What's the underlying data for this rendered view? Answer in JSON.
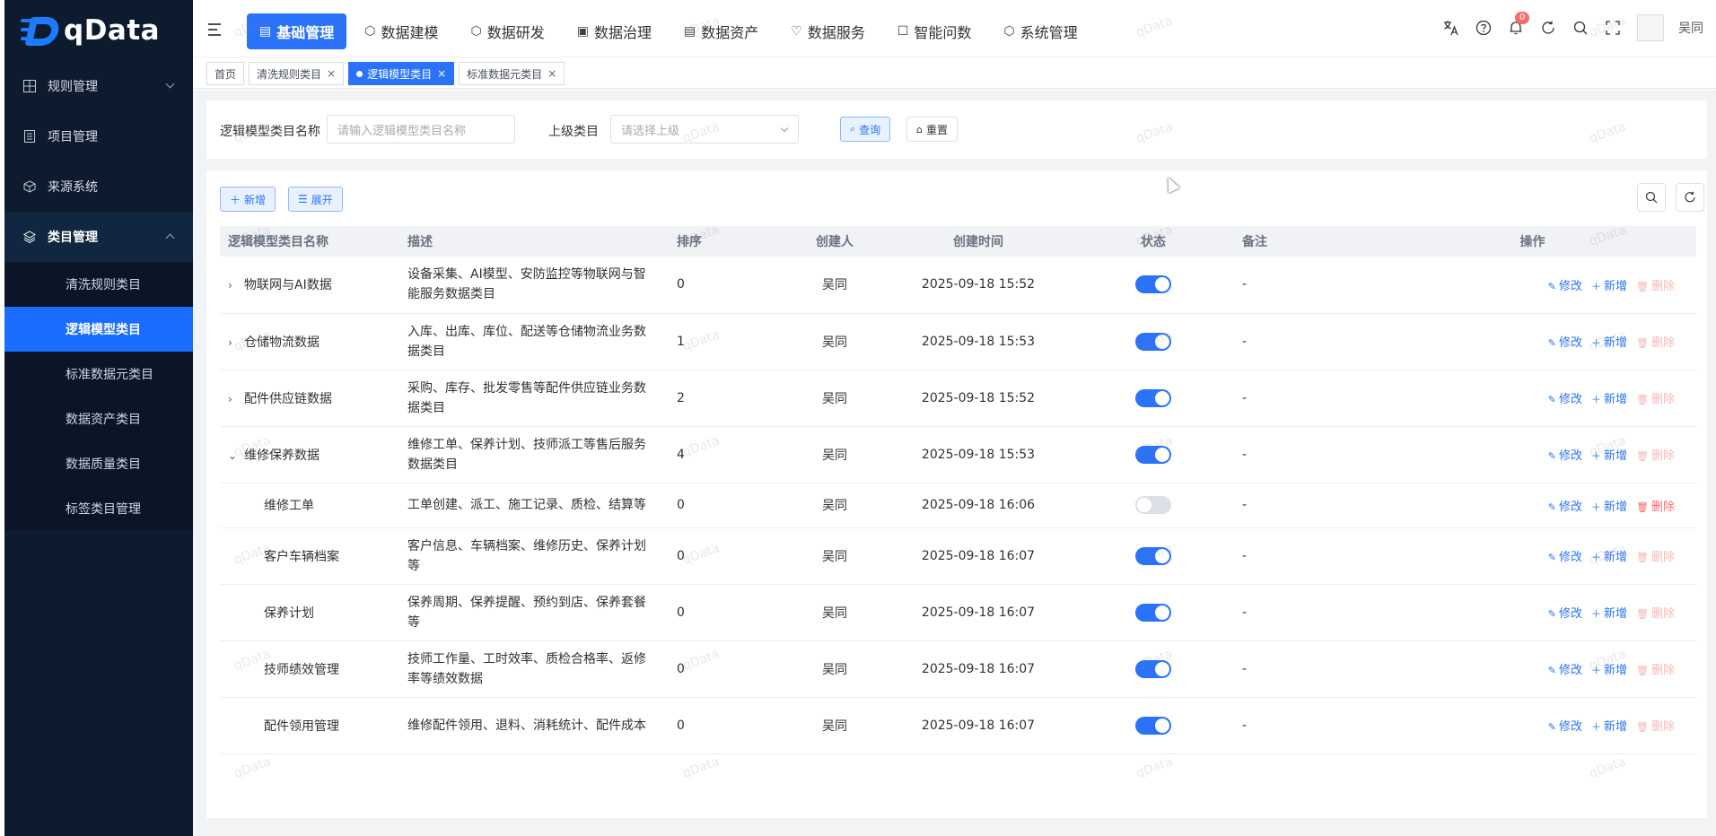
{
  "app": {
    "logo_text": "qData"
  },
  "sidebar": {
    "items": [
      {
        "label": "规则管理",
        "icon": "grid-icon"
      },
      {
        "label": "项目管理",
        "icon": "document-icon"
      },
      {
        "label": "来源系统",
        "icon": "cube-icon"
      },
      {
        "label": "类目管理",
        "icon": "layers-icon"
      }
    ],
    "sub_items": [
      {
        "label": "清洗规则类目"
      },
      {
        "label": "逻辑模型类目"
      },
      {
        "label": "标准数据元类目"
      },
      {
        "label": "数据资产类目"
      },
      {
        "label": "数据质量类目"
      },
      {
        "label": "标签类目管理"
      }
    ]
  },
  "topnav": {
    "items": [
      {
        "label": "基础管理",
        "icon": "▤"
      },
      {
        "label": "数据建模",
        "icon": "⬡"
      },
      {
        "label": "数据研发",
        "icon": "⬡"
      },
      {
        "label": "数据治理",
        "icon": "▣"
      },
      {
        "label": "数据资产",
        "icon": "▤"
      },
      {
        "label": "数据服务",
        "icon": "♡"
      },
      {
        "label": "智能问数",
        "icon": "☐"
      },
      {
        "label": "系统管理",
        "icon": "⬡"
      }
    ],
    "badge_count": "0",
    "user_name": "吴同"
  },
  "tabs": [
    {
      "label": "首页"
    },
    {
      "label": "清洗规则类目"
    },
    {
      "label": "逻辑模型类目"
    },
    {
      "label": "标准数据元类目"
    }
  ],
  "search": {
    "name_label": "逻辑模型类目名称",
    "name_placeholder": "请输入逻辑模型类目名称",
    "parent_label": "上级类目",
    "parent_placeholder": "请选择上级",
    "query_button": "查询",
    "reset_button": "重置"
  },
  "toolbar": {
    "add_button": "新增",
    "expand_button": "展开"
  },
  "table": {
    "headers": [
      "逻辑模型类目名称",
      "描述",
      "排序",
      "创建人",
      "创建时间",
      "状态",
      "备注",
      "操作"
    ],
    "actions": {
      "edit": "修改",
      "add": "新增",
      "delete": "删除"
    },
    "rows": [
      {
        "name": "物联网与AI数据",
        "desc": "设备采集、AI模型、安防监控等物联网与智能服务数据类目",
        "sort": "0",
        "creator": "吴同",
        "time": "2025-09-18 15:52",
        "enabled": true,
        "remark": "-"
      },
      {
        "name": "仓储物流数据",
        "desc": "入库、出库、库位、配送等仓储物流业务数据类目",
        "sort": "1",
        "creator": "吴同",
        "time": "2025-09-18 15:53",
        "enabled": true,
        "remark": "-"
      },
      {
        "name": "配件供应链数据",
        "desc": "采购、库存、批发零售等配件供应链业务数据类目",
        "sort": "2",
        "creator": "吴同",
        "time": "2025-09-18 15:52",
        "enabled": true,
        "remark": "-"
      },
      {
        "name": "维修保养数据",
        "desc": "维修工单、保养计划、技师派工等售后服务数据类目",
        "sort": "4",
        "creator": "吴同",
        "time": "2025-09-18 15:53",
        "enabled": true,
        "remark": "-"
      },
      {
        "name": "维修工单",
        "desc": "工单创建、派工、施工记录、质检、结算等",
        "sort": "0",
        "creator": "吴同",
        "time": "2025-09-18 16:06",
        "enabled": false,
        "remark": "-"
      },
      {
        "name": "客户车辆档案",
        "desc": "客户信息、车辆档案、维修历史、保养计划等",
        "sort": "0",
        "creator": "吴同",
        "time": "2025-09-18 16:07",
        "enabled": true,
        "remark": "-"
      },
      {
        "name": "保养计划",
        "desc": "保养周期、保养提醒、预约到店、保养套餐等",
        "sort": "0",
        "creator": "吴同",
        "time": "2025-09-18 16:07",
        "enabled": true,
        "remark": "-"
      },
      {
        "name": "技师绩效管理",
        "desc": "技师工作量、工时效率、质检合格率、返修率等绩效数据",
        "sort": "0",
        "creator": "吴同",
        "time": "2025-09-18 16:07",
        "enabled": true,
        "remark": "-"
      },
      {
        "name": "配件领用管理",
        "desc": "维修配件领用、退料、消耗统计、配件成本",
        "sort": "0",
        "creator": "吴同",
        "time": "2025-09-18 16:07",
        "enabled": true,
        "remark": "-"
      }
    ]
  },
  "watermark": "qData"
}
